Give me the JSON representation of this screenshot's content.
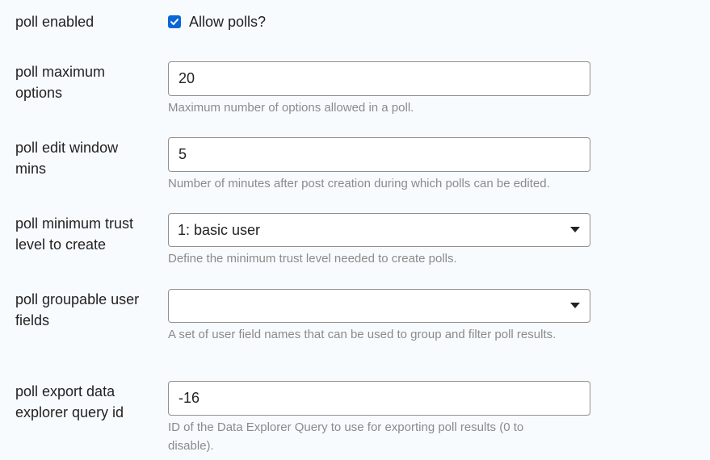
{
  "settings": {
    "poll_enabled": {
      "label": "poll enabled",
      "checkbox_label": "Allow polls?",
      "checked": true
    },
    "poll_maximum_options": {
      "label": "poll maximum options",
      "value": "20",
      "help": "Maximum number of options allowed in a poll."
    },
    "poll_edit_window_mins": {
      "label": "poll edit window mins",
      "value": "5",
      "help": "Number of minutes after post creation during which polls can be edited."
    },
    "poll_minimum_trust_level": {
      "label": "poll minimum trust level to create",
      "value": "1: basic user",
      "help": "Define the minimum trust level needed to create polls."
    },
    "poll_groupable_user_fields": {
      "label": "poll groupable user fields",
      "value": "",
      "help": "A set of user field names that can be used to group and filter poll results."
    },
    "poll_export_query_id": {
      "label": "poll export data explorer query id",
      "value": "-16",
      "help": "ID of the Data Explorer Query to use for exporting poll results (0 to disable)."
    }
  },
  "colors": {
    "accent": "#0a66d6",
    "help_text": "#8a8a8a",
    "border": "#919191",
    "background": "#f8fbfe"
  },
  "icons": {
    "checkbox": "checkmark-icon",
    "dropdown": "caret-down-icon"
  }
}
